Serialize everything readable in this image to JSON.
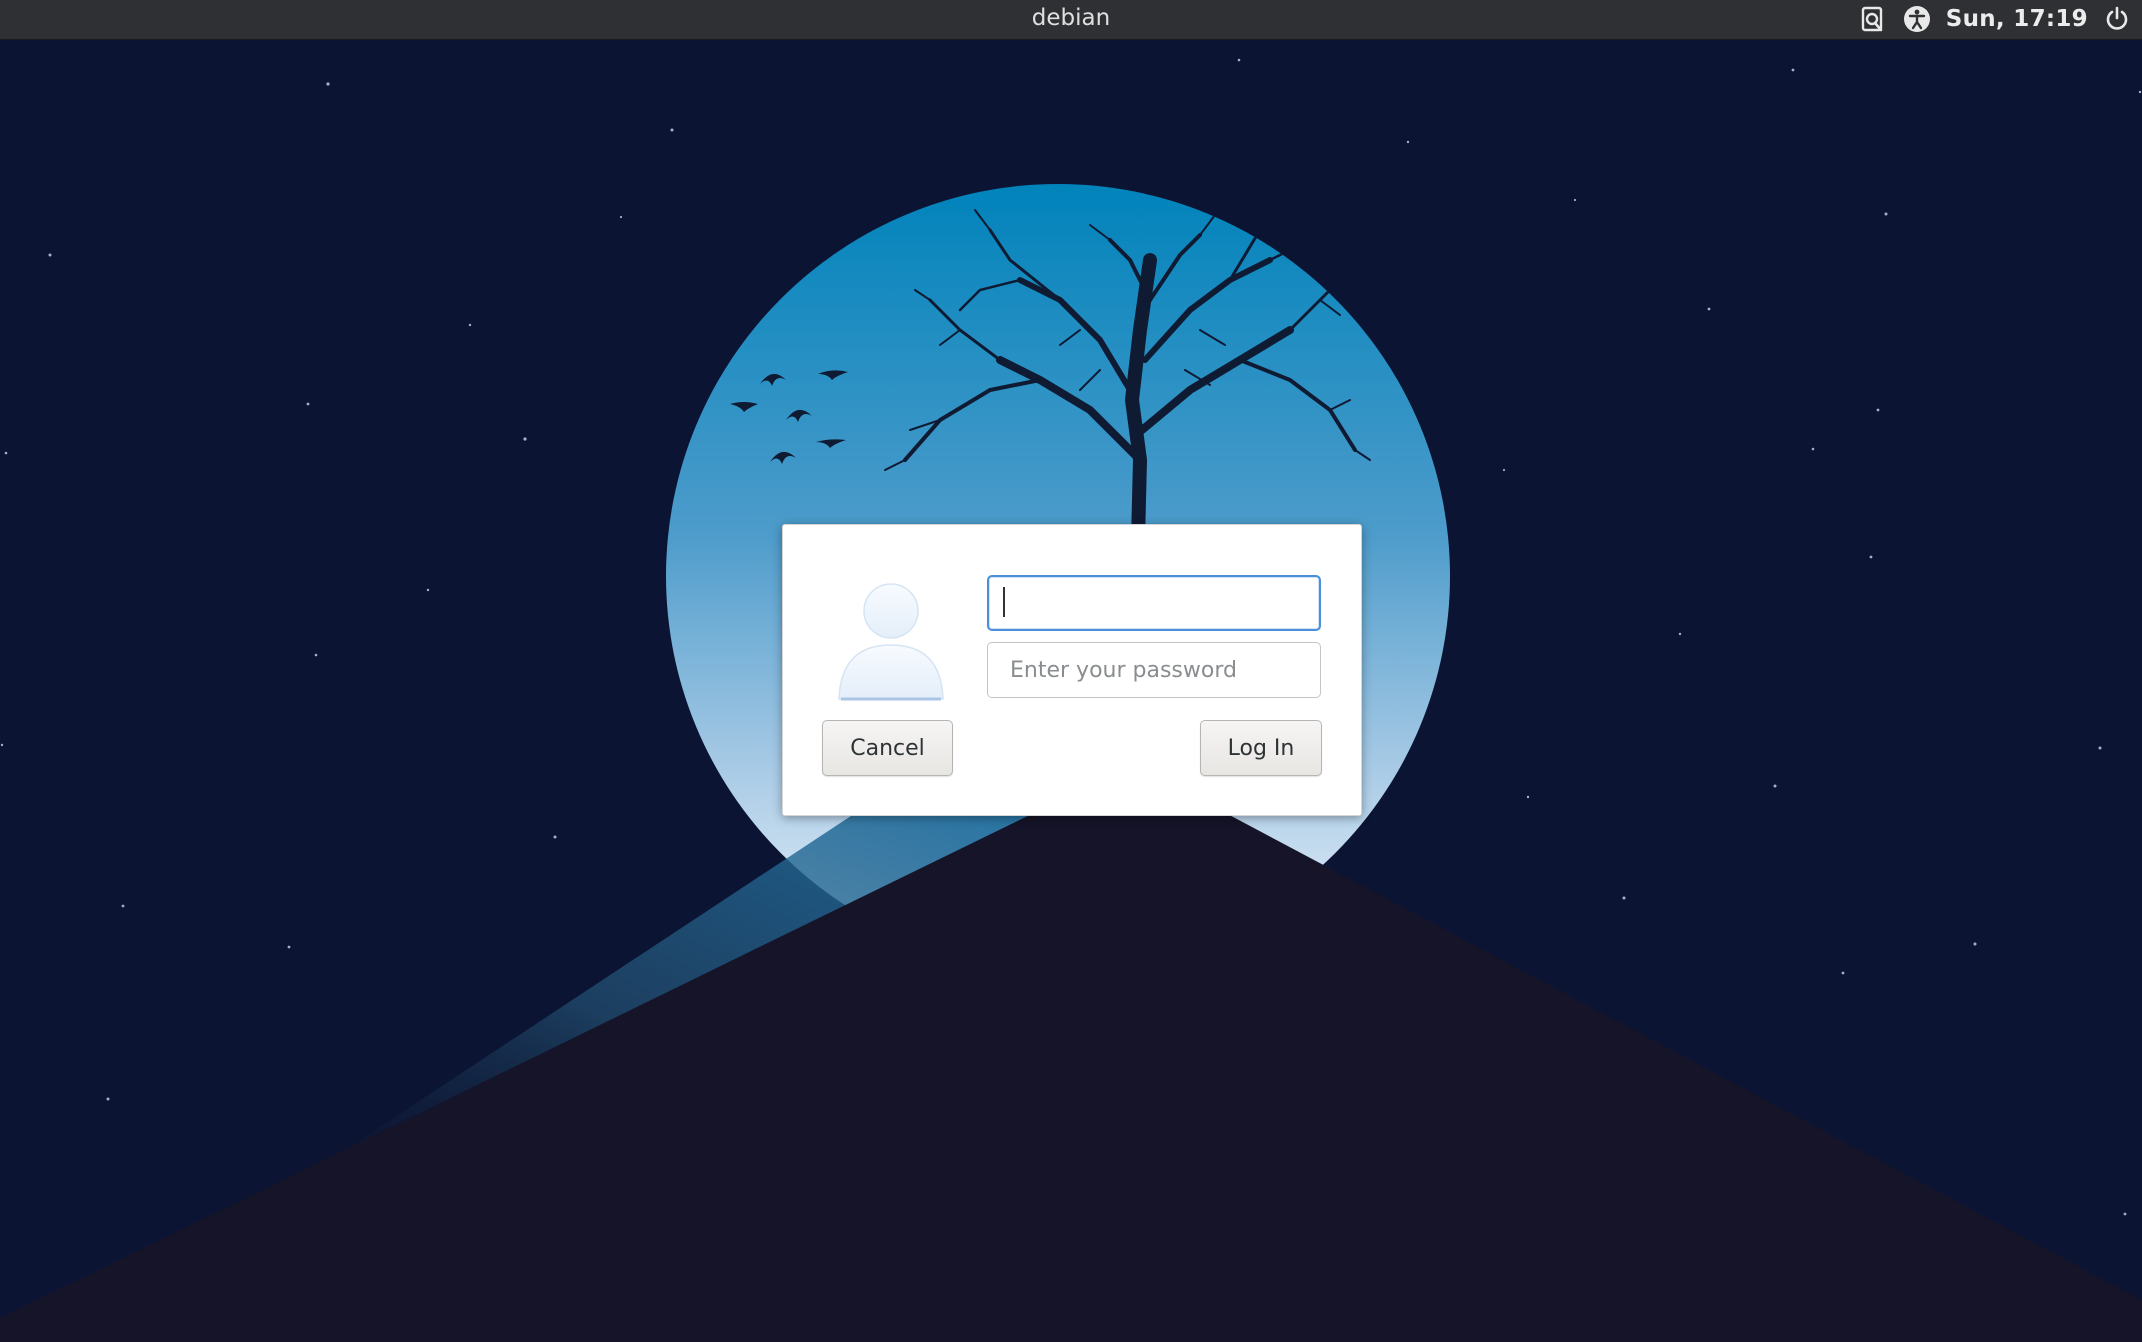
{
  "panel": {
    "hostname": "debian",
    "clock": "Sun, 17:19",
    "icons": [
      "screen-capture-icon",
      "accessibility-icon",
      "power-icon"
    ]
  },
  "login": {
    "username_value": "",
    "password_placeholder": "Enter your password",
    "cancel_label": "Cancel",
    "login_label": "Log In"
  },
  "colors": {
    "sky": "#0b1533",
    "moon_top": "#0083bb",
    "moon_bottom": "#e9f2fa",
    "mountain": "#151428",
    "focus": "#4a90d9"
  }
}
